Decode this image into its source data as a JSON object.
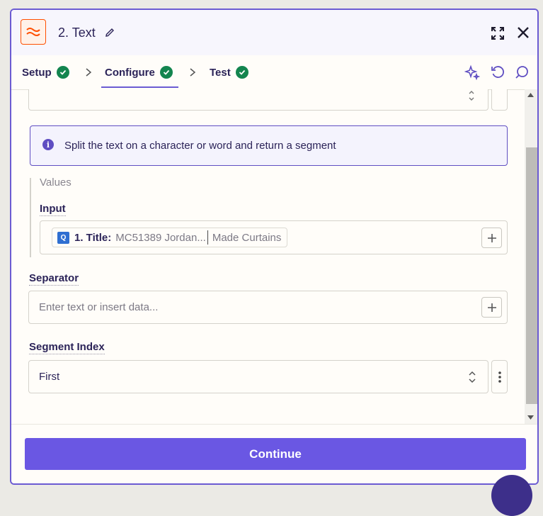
{
  "header": {
    "title": "2. Text"
  },
  "tabs": [
    {
      "label": "Setup"
    },
    {
      "label": "Configure"
    },
    {
      "label": "Test"
    }
  ],
  "info": {
    "text": "Split the text on a character or word and return a segment"
  },
  "values": {
    "section_label": "Values",
    "input_label": "Input",
    "input_pill": {
      "step_label": "1. Title:",
      "value": "MC51389 Jordan...",
      "value_rest": "Made Curtains"
    }
  },
  "separator": {
    "label": "Separator",
    "placeholder": "Enter text or insert data..."
  },
  "segment_index": {
    "label": "Segment Index",
    "selected": "First"
  },
  "footer": {
    "continue_label": "Continue"
  },
  "colors": {
    "accent": "#6a57e3",
    "success": "#13854f",
    "app_orange": "#ff4f00"
  }
}
